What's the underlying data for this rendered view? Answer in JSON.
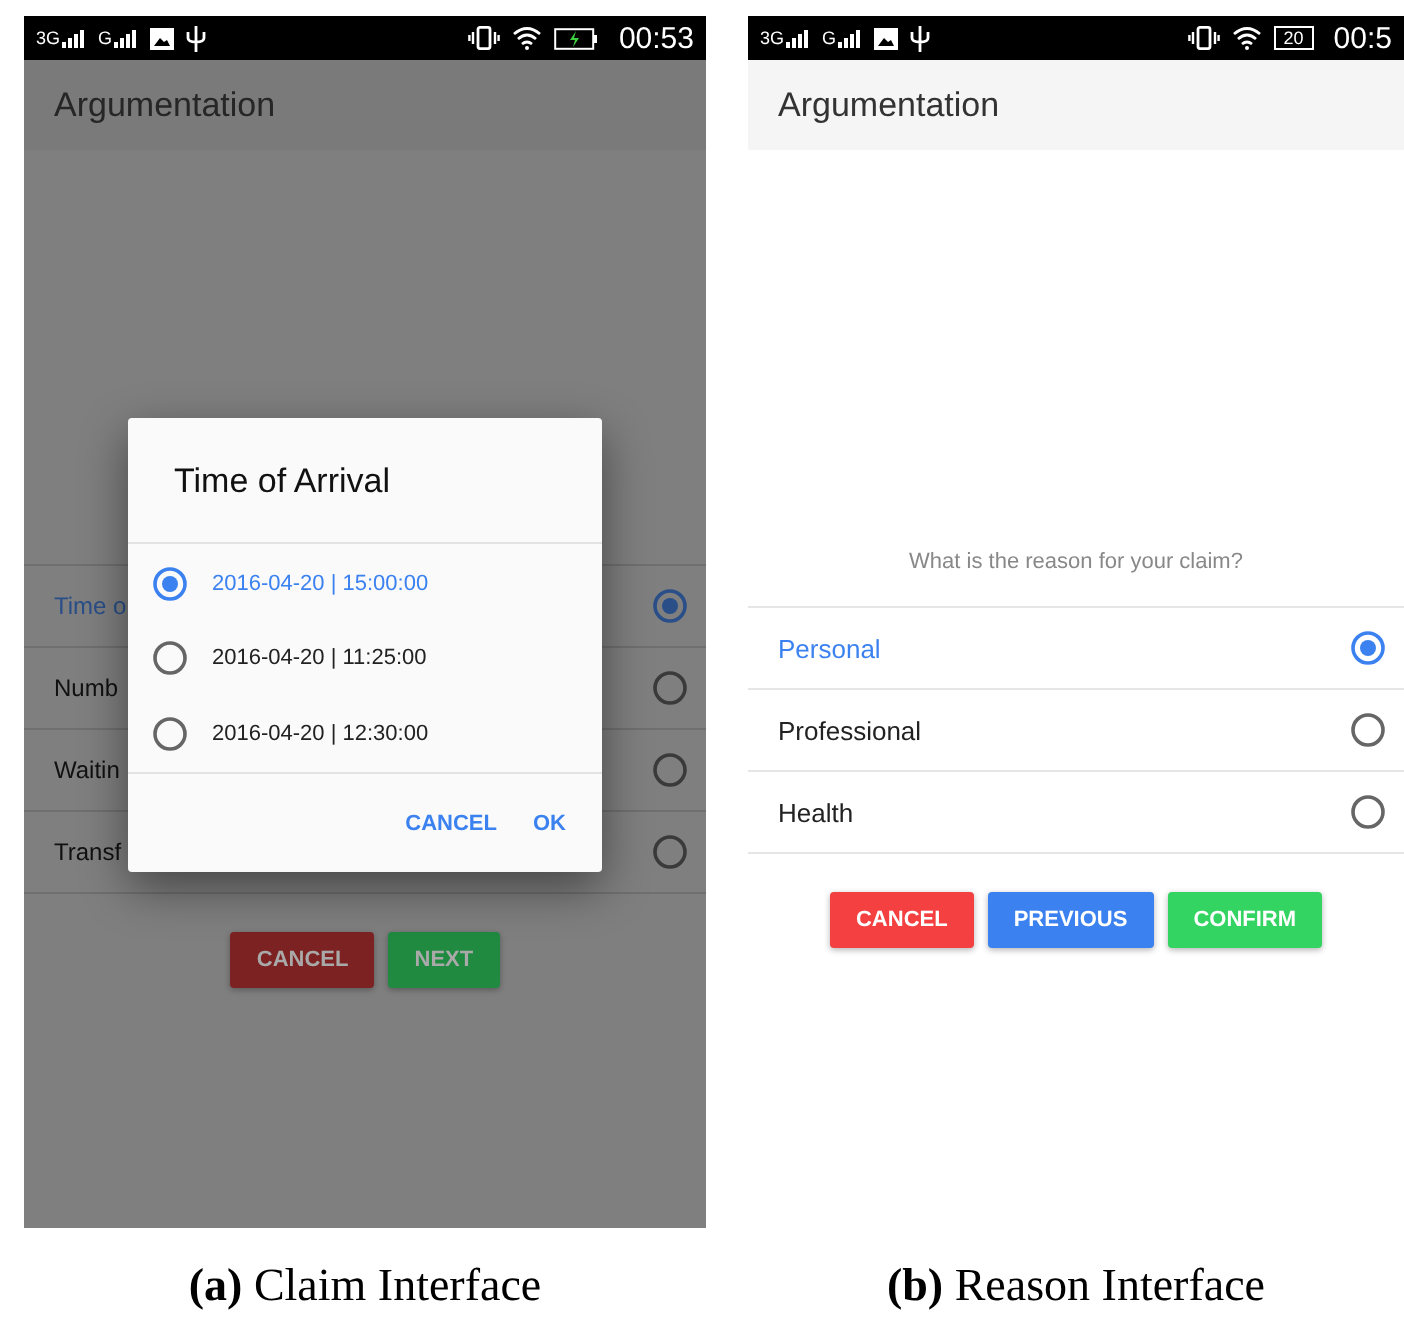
{
  "figures": [
    {
      "caption_label": "(a)",
      "caption": "Claim Interface",
      "screen": {
        "dimmed": true,
        "status_bar": {
          "networks": [
            "3G",
            "G"
          ],
          "battery": {
            "charging": true
          },
          "time": "00:53"
        },
        "app_bar": {
          "title": "Argumentation"
        },
        "options": [
          {
            "label": "Time o",
            "selected": true
          },
          {
            "label": "Numb",
            "selected": false
          },
          {
            "label": "Waitin",
            "selected": false
          },
          {
            "label": "Transf",
            "selected": false
          }
        ],
        "buttons": [
          {
            "label": "CANCEL",
            "color": "#7d2222"
          },
          {
            "label": "NEXT",
            "color": "#1f8a40"
          }
        ],
        "dialog": {
          "title": "Time of Arrival",
          "options": [
            {
              "label": "2016-04-20 | 15:00:00",
              "selected": true
            },
            {
              "label": "2016-04-20 | 11:25:00",
              "selected": false
            },
            {
              "label": "2016-04-20 | 12:30:00",
              "selected": false
            }
          ],
          "actions": [
            "CANCEL",
            "OK"
          ]
        }
      }
    },
    {
      "caption_label": "(b)",
      "caption": "Reason Interface",
      "screen": {
        "dimmed": false,
        "status_bar": {
          "networks": [
            "3G",
            "G"
          ],
          "battery": {
            "charging": false,
            "text": "20"
          },
          "time": "00:5"
        },
        "app_bar": {
          "title": "Argumentation"
        },
        "question": "What is the reason for your claim?",
        "options": [
          {
            "label": "Personal",
            "selected": true
          },
          {
            "label": "Professional",
            "selected": false
          },
          {
            "label": "Health",
            "selected": false
          }
        ],
        "buttons": [
          {
            "label": "CANCEL",
            "color": "#f44040"
          },
          {
            "label": "PREVIOUS",
            "color": "#3b82f0"
          },
          {
            "label": "CONFIRM",
            "color": "#34d462"
          }
        ]
      }
    }
  ]
}
